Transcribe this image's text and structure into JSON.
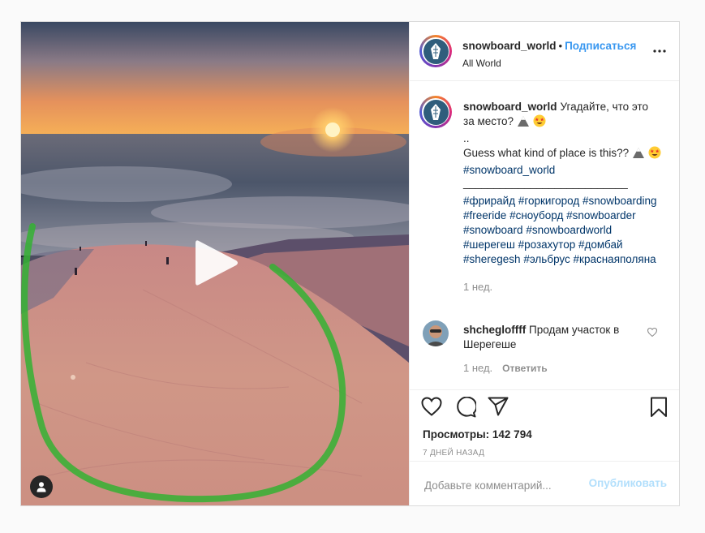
{
  "post": {
    "username": "snowboard_world",
    "separator": "•",
    "follow_label": "Подписаться",
    "location": "All World"
  },
  "caption": {
    "line1": "Угадайте, что это за место?",
    "dots": "..",
    "line2": "Guess what kind of place is this??",
    "tag_main": "#snowboard_world",
    "divider": "___________________________",
    "tags": [
      "#фрирайд",
      "#горкигород",
      "#snowboarding",
      "#freeride",
      "#сноуборд",
      "#snowboarder",
      "#snowboard",
      "#snowboardworld",
      "#шерегеш",
      "#розахутор",
      "#домбай",
      "#sheregesh",
      "#эльбрус",
      "#краснаяполяна"
    ],
    "time": "1 нед."
  },
  "comment": {
    "username": "shchegloffff",
    "text": "Продам участок в Шерегеше",
    "time": "1 нед.",
    "reply_label": "Ответить"
  },
  "stats": {
    "views_label": "Просмотры:",
    "views_value": "142 794",
    "date": "7 ДНЕЙ НАЗАД"
  },
  "add_comment": {
    "placeholder": "Добавьте комментарий...",
    "publish_label": "Опубликовать"
  },
  "colors": {
    "link_blue": "#3897f0",
    "hashtag": "#003569",
    "muted": "#8e8e8e",
    "publish_disabled": "#b2dffc",
    "annotation_green": "#34b233"
  },
  "icons": [
    "play-icon",
    "user-tag-icon",
    "more-icon",
    "heart-icon",
    "comment-icon",
    "share-icon",
    "bookmark-icon",
    "mountain-emoji-icon",
    "star-eyes-emoji-icon"
  ]
}
